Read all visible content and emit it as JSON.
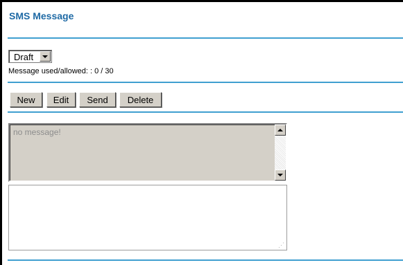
{
  "page": {
    "title": "SMS Message"
  },
  "mailbox": {
    "selected": "Draft",
    "icon": "chevron-down-icon"
  },
  "usage": {
    "text": "Message used/allowed: : 0 / 30"
  },
  "toolbar": {
    "new_label": "New",
    "edit_label": "Edit",
    "send_label": "Send",
    "delete_label": "Delete"
  },
  "message_view": {
    "text": "no message!"
  },
  "compose": {
    "value": ""
  },
  "colors": {
    "title": "#1f6aa5",
    "rule": "#3f9fd0",
    "button_face": "#d4d0c8",
    "message_bg": "#d4d0c8"
  }
}
